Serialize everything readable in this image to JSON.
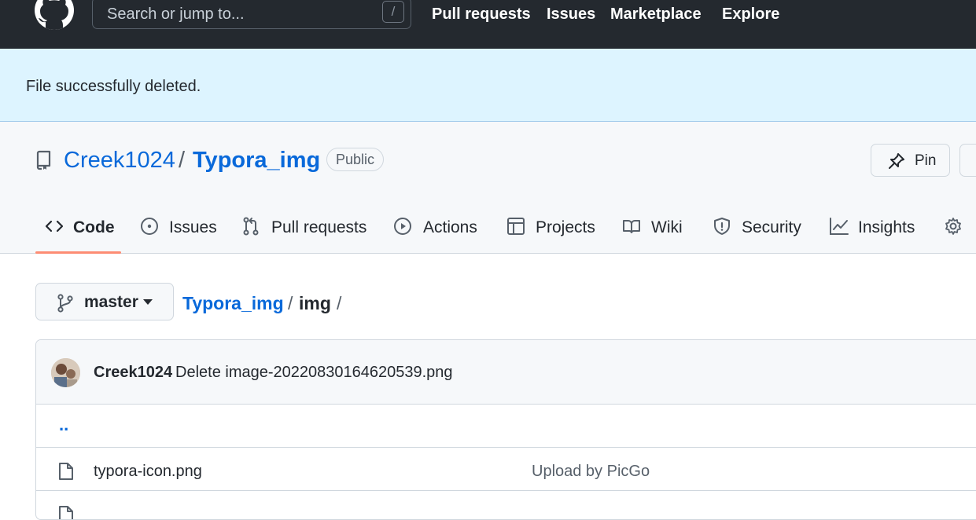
{
  "header": {
    "search_placeholder": "Search or jump to...",
    "search_shortcut": "/",
    "nav": [
      "Pull requests",
      "Issues",
      "Marketplace",
      "Explore"
    ]
  },
  "flash": {
    "message": "File successfully deleted."
  },
  "repo": {
    "owner": "Creek1024",
    "separator": "/",
    "name": "Typora_img",
    "visibility": "Public",
    "pin_label": "Pin"
  },
  "tabs": [
    {
      "label": "Code",
      "icon": "code-icon",
      "selected": true
    },
    {
      "label": "Issues",
      "icon": "issue-icon"
    },
    {
      "label": "Pull requests",
      "icon": "pull-request-icon"
    },
    {
      "label": "Actions",
      "icon": "play-icon"
    },
    {
      "label": "Projects",
      "icon": "table-icon"
    },
    {
      "label": "Wiki",
      "icon": "book-icon"
    },
    {
      "label": "Security",
      "icon": "shield-icon"
    },
    {
      "label": "Insights",
      "icon": "graph-icon"
    },
    {
      "label": "",
      "icon": "gear-icon"
    }
  ],
  "branch": {
    "name": "master"
  },
  "breadcrumb": {
    "root": "Typora_img",
    "sep": "/",
    "dir": "img"
  },
  "commit": {
    "author": "Creek1024",
    "message": "Delete image-20220830164620539.png"
  },
  "files": {
    "parent": "..",
    "items": [
      {
        "name": "typora-icon.png",
        "commit": "Upload by PicGo"
      },
      {
        "name": "",
        "commit": ""
      }
    ]
  },
  "colors": {
    "header_bg": "#24292f",
    "flash_bg": "#ddf4ff",
    "link": "#0969da",
    "tab_underline": "#fd8c73"
  }
}
